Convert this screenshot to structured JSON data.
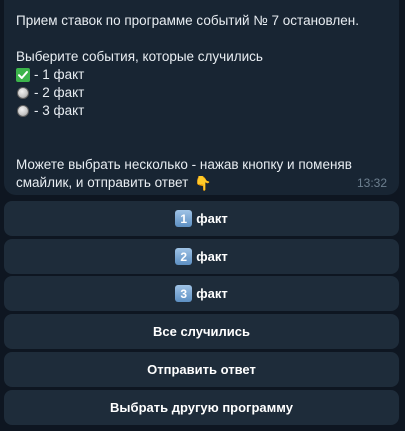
{
  "message": {
    "line1": "Прием ставок по программе событий № 7 остановлен.",
    "line2": "Выберите события, которые случились",
    "options": [
      {
        "status_icon": "check-mark-icon",
        "label": "- 1 факт"
      },
      {
        "status_icon": "white-circle-icon",
        "label": "- 2 факт"
      },
      {
        "status_icon": "white-circle-icon",
        "label": "- 3 факт"
      }
    ],
    "footer_line1": "Можете выбрать несколько - нажав кнопку и поменяв",
    "footer_line2": "смайлик, и отправить ответ",
    "footer_emoji": "👇",
    "time": "13:32"
  },
  "keyboard": {
    "buttons": [
      {
        "keycap": "1",
        "label": "факт"
      },
      {
        "keycap": "2",
        "label": "факт"
      },
      {
        "keycap": "3",
        "label": "факт"
      },
      {
        "label": "Все случились"
      },
      {
        "label": "Отправить ответ"
      },
      {
        "label": "Выбрать другую программу"
      }
    ]
  },
  "colors": {
    "background": "#0e1621",
    "bubble": "#182533",
    "button": "#1e2c3a",
    "text": "#e8edf2",
    "time": "#6d7f8f",
    "check": "#3cb44b"
  }
}
